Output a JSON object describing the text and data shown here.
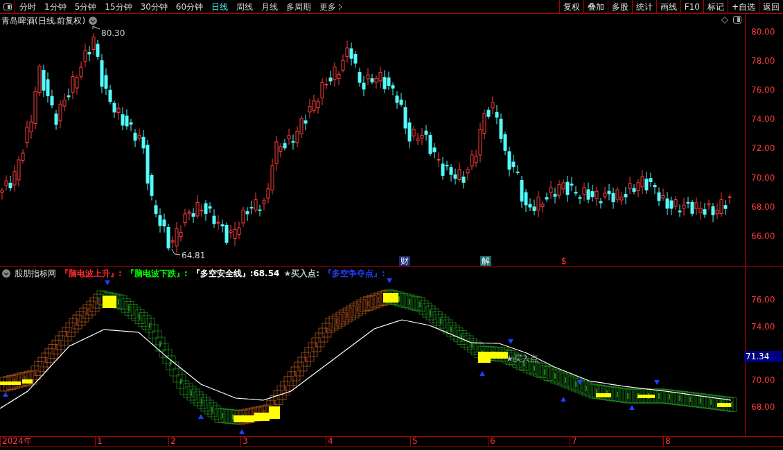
{
  "toolbar": {
    "periods": [
      {
        "label": "分时",
        "selected": false
      },
      {
        "label": "1分钟",
        "selected": false
      },
      {
        "label": "5分钟",
        "selected": false
      },
      {
        "label": "15分钟",
        "selected": false
      },
      {
        "label": "30分钟",
        "selected": false
      },
      {
        "label": "60分钟",
        "selected": false
      },
      {
        "label": "日线",
        "selected": true
      },
      {
        "label": "周线",
        "selected": false
      },
      {
        "label": "月线",
        "selected": false
      },
      {
        "label": "多周期",
        "selected": false
      }
    ],
    "more": "更多",
    "buttons": [
      "复权",
      "叠加",
      "多股",
      "统计",
      "画线",
      "F10",
      "标记",
      "+自选",
      "返回"
    ]
  },
  "price_chart": {
    "title": "青岛啤酒(日线.前复权)",
    "axis_ticks": [
      "80.00",
      "78.00",
      "76.00",
      "74.00",
      "72.00",
      "70.00",
      "68.00",
      "66.00"
    ],
    "high_label": "80.30",
    "low_label": "64.81",
    "markers": [
      {
        "label": "财",
        "kind": "finance"
      },
      {
        "label": "解",
        "kind": "unlock"
      },
      {
        "label": "$",
        "kind": "dividend"
      }
    ]
  },
  "indicator": {
    "name": "股朋指标网",
    "legend": [
      {
        "text": "『脑电波上升』:",
        "color": "#ff2a2a"
      },
      {
        "text": "『脑电波下跌』:",
        "color": "#00ff00"
      },
      {
        "text": "『多空安全线』:68.54",
        "color": "#ffffff"
      },
      {
        "text": "★买入点:",
        "color": "#b4c8c8"
      },
      {
        "text": "『多空争夺点』:",
        "color": "#2040ff"
      }
    ],
    "axis_ticks": [
      "76.00",
      "74.00",
      "70.00",
      "68.00"
    ],
    "current_value": "71.34",
    "chart_label": "★买入点"
  },
  "time_axis": [
    "2024年",
    "1",
    "2",
    "3",
    "4",
    "5",
    "6",
    "7",
    "8"
  ]
}
